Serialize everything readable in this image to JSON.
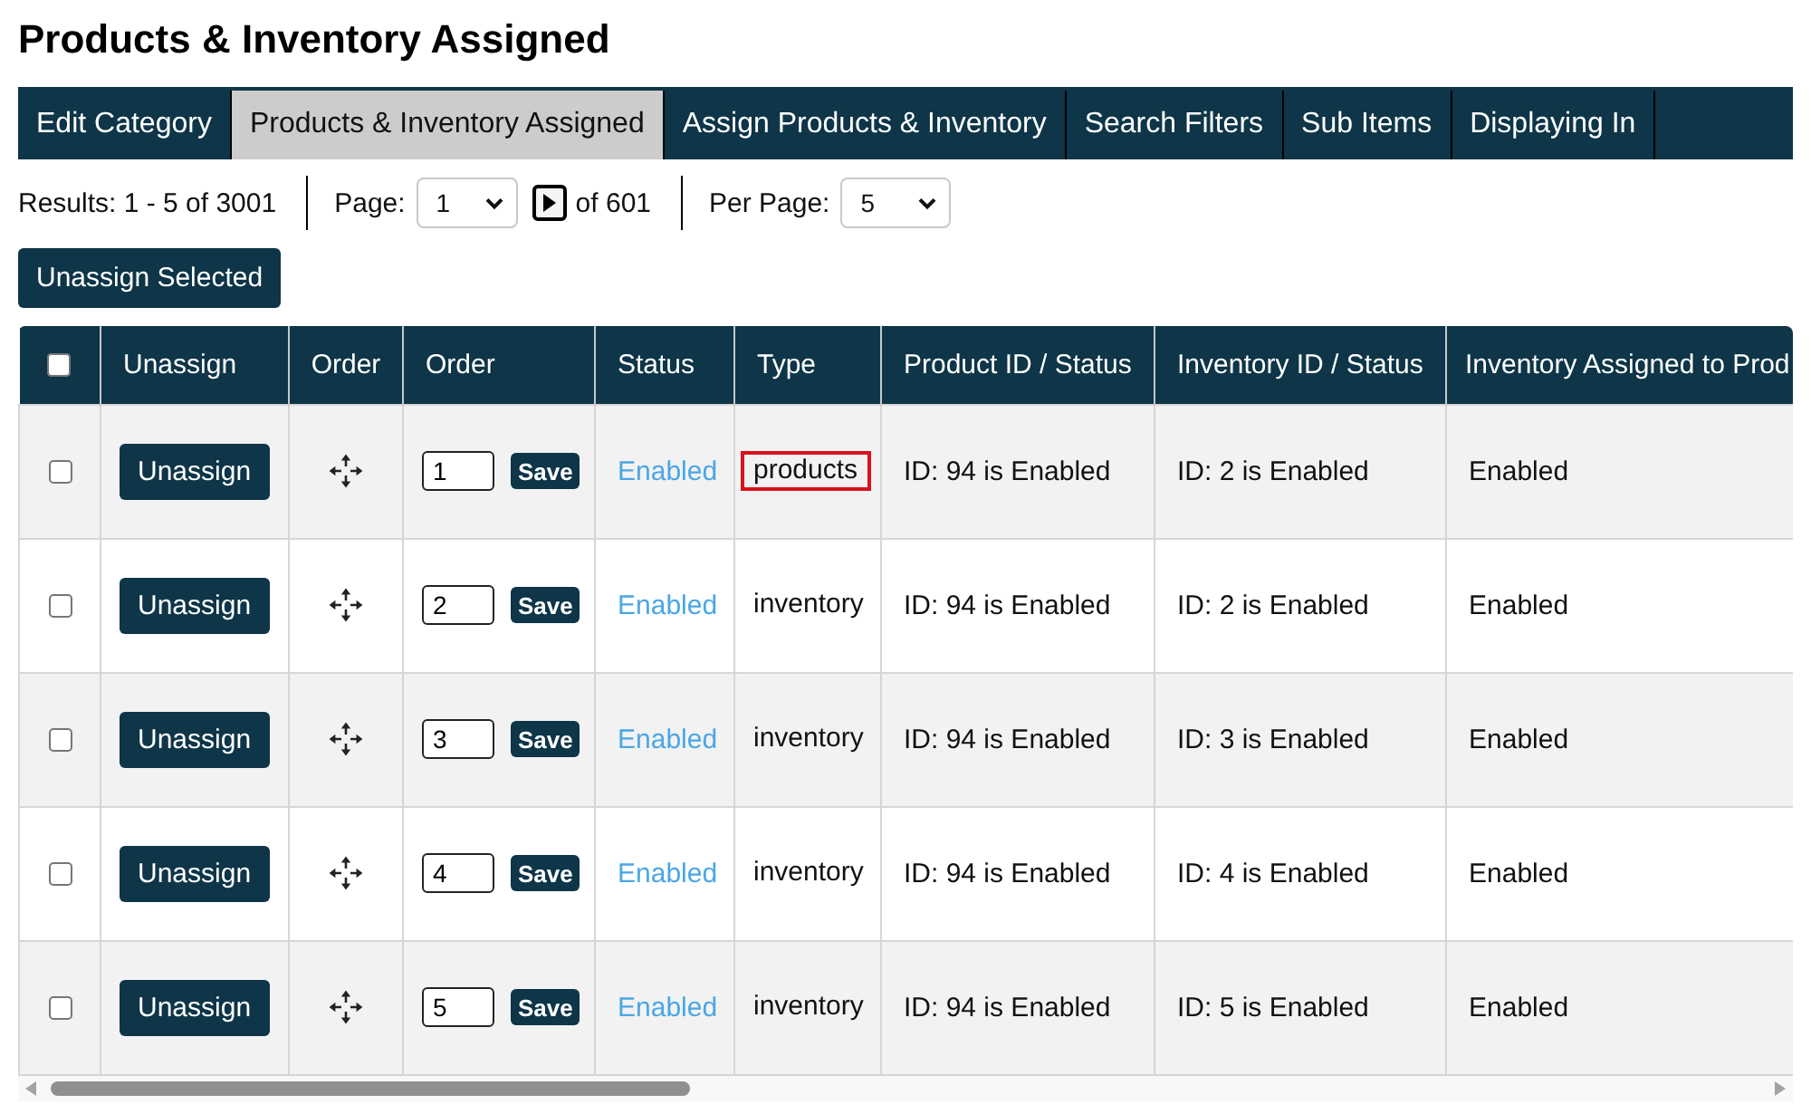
{
  "page": {
    "title": "Products & Inventory Assigned"
  },
  "tabs": [
    {
      "label": "Edit Category",
      "selected": false
    },
    {
      "label": "Products & Inventory Assigned",
      "selected": true
    },
    {
      "label": "Assign Products & Inventory",
      "selected": false
    },
    {
      "label": "Search Filters",
      "selected": false
    },
    {
      "label": "Sub Items",
      "selected": false
    },
    {
      "label": "Displaying In",
      "selected": false
    }
  ],
  "pagination": {
    "results": "Results: 1 - 5 of 3001",
    "page_label": "Page:",
    "page_value": "1",
    "page_total": "of 601",
    "per_page_label": "Per Page:",
    "per_page_value": "5"
  },
  "actions": {
    "unassign_selected": "Unassign Selected"
  },
  "table": {
    "columns": [
      {
        "kind": "checkbox",
        "checked": false
      },
      {
        "kind": "text",
        "label": "Unassign"
      },
      {
        "kind": "text",
        "label": "Order"
      },
      {
        "kind": "text",
        "label": "Order"
      },
      {
        "kind": "text",
        "label": "Status"
      },
      {
        "kind": "text",
        "label": "Type"
      },
      {
        "kind": "text",
        "label": "Product ID / Status"
      },
      {
        "kind": "text",
        "label": "Inventory ID / Status"
      },
      {
        "kind": "text",
        "label": "Inventory Assigned to Prod"
      }
    ],
    "rows": [
      {
        "checked": false,
        "unassign": "Unassign",
        "order": "1",
        "save": "Save",
        "status": "Enabled",
        "type": "products",
        "type_flagged": true,
        "product": "ID: 94 is Enabled",
        "inventory": "ID: 2 is Enabled",
        "assigned": "Enabled"
      },
      {
        "checked": false,
        "unassign": "Unassign",
        "order": "2",
        "save": "Save",
        "status": "Enabled",
        "type": "inventory",
        "type_flagged": false,
        "product": "ID: 94 is Enabled",
        "inventory": "ID: 2 is Enabled",
        "assigned": "Enabled"
      },
      {
        "checked": false,
        "unassign": "Unassign",
        "order": "3",
        "save": "Save",
        "status": "Enabled",
        "type": "inventory",
        "type_flagged": false,
        "product": "ID: 94 is Enabled",
        "inventory": "ID: 3 is Enabled",
        "assigned": "Enabled"
      },
      {
        "checked": false,
        "unassign": "Unassign",
        "order": "4",
        "save": "Save",
        "status": "Enabled",
        "type": "inventory",
        "type_flagged": false,
        "product": "ID: 94 is Enabled",
        "inventory": "ID: 4 is Enabled",
        "assigned": "Enabled"
      },
      {
        "checked": false,
        "unassign": "Unassign",
        "order": "5",
        "save": "Save",
        "status": "Enabled",
        "type": "inventory",
        "type_flagged": false,
        "product": "ID: 94 is Enabled",
        "inventory": "ID: 5 is Enabled",
        "assigned": "Enabled"
      }
    ]
  }
}
